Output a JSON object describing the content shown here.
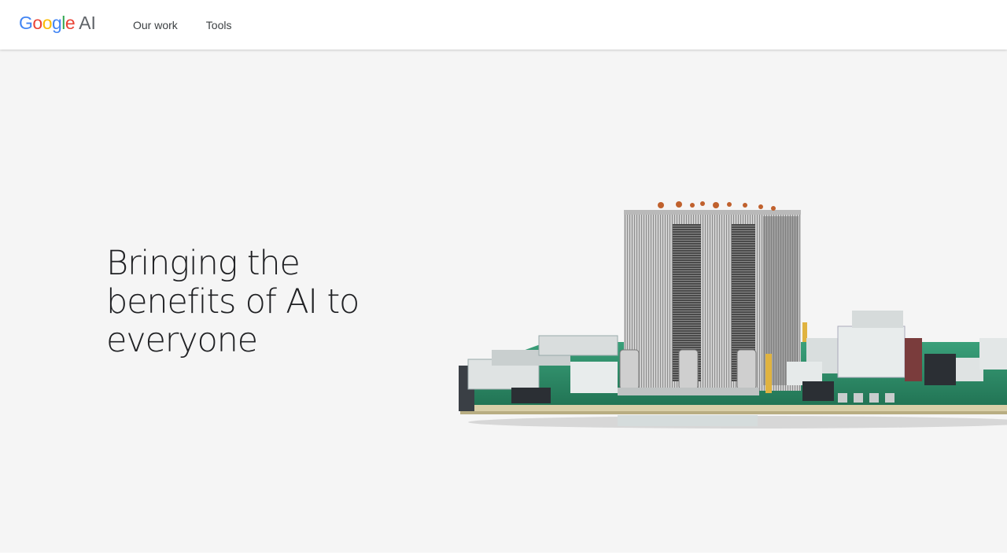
{
  "header": {
    "logo_word": "Google",
    "logo_suffix": "AI",
    "logo_colors": [
      "#4285F4",
      "#EA4335",
      "#FBBC05",
      "#4285F4",
      "#34A853",
      "#EA4335"
    ],
    "nav": [
      {
        "label": "Our work"
      },
      {
        "label": "Tools"
      }
    ]
  },
  "hero": {
    "title_line1": "Bringing the",
    "title_line2": "benefits of AI to",
    "title_line3": "everyone",
    "image_icon": "tpu-circuit-board-image"
  },
  "colors": {
    "background": "#f5f5f5",
    "header_bg": "#ffffff",
    "text": "#202124",
    "pcb_green": "#2f8f6a"
  }
}
